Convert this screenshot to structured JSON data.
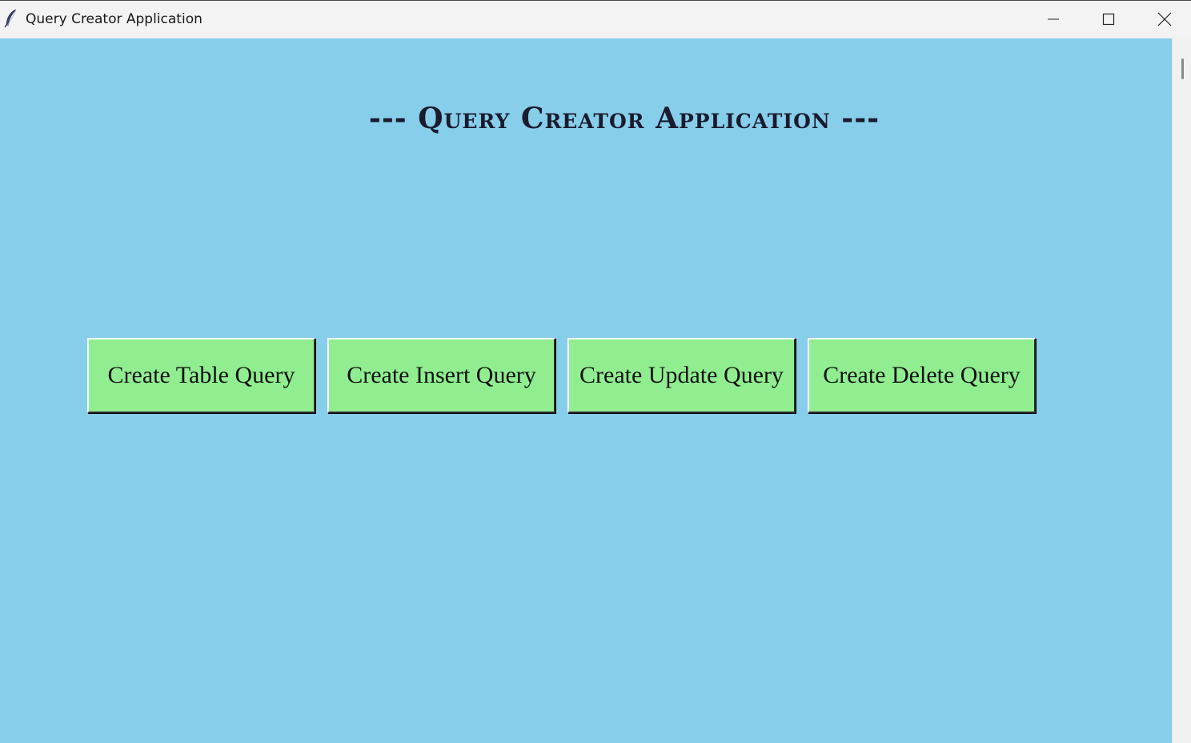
{
  "window": {
    "title": "Query Creator Application",
    "icons": {
      "app": "feather-icon",
      "minimize": "minimize-icon",
      "maximize": "maximize-icon",
      "close": "close-icon"
    }
  },
  "main": {
    "heading": "--- Query Creator Application ---",
    "buttons": [
      {
        "label": "Create Table Query"
      },
      {
        "label": "Create Insert Query"
      },
      {
        "label": "Create Update Query"
      },
      {
        "label": "Create Delete Query"
      }
    ]
  },
  "colors": {
    "background": "#87ceeb",
    "button": "#90ee90",
    "titlebar": "#f3f3f3"
  }
}
